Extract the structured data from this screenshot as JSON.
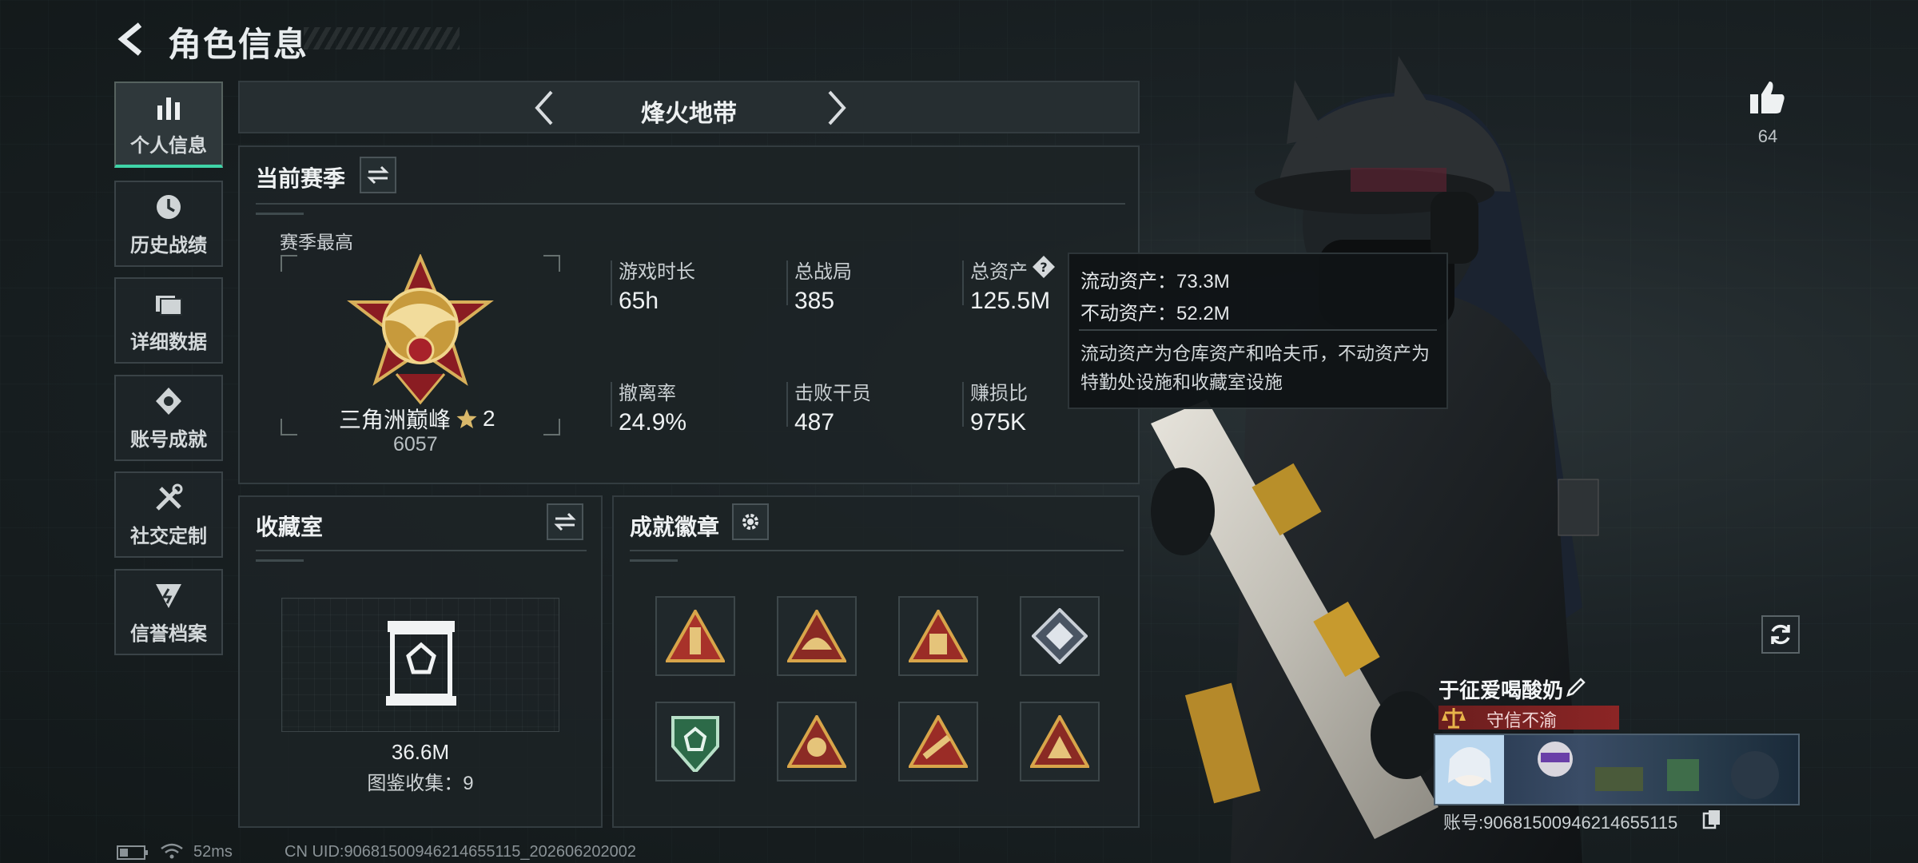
{
  "header": {
    "title": "角色信息"
  },
  "nav": {
    "items": [
      {
        "label": "个人信息",
        "icon": "bar-chart-icon",
        "active": true
      },
      {
        "label": "历史战绩",
        "icon": "history-icon",
        "active": false
      },
      {
        "label": "详细数据",
        "icon": "folder-icon",
        "active": false
      },
      {
        "label": "账号成就",
        "icon": "achievement-icon",
        "active": false
      },
      {
        "label": "社交定制",
        "icon": "tools-icon",
        "active": false
      },
      {
        "label": "信誉档案",
        "icon": "credit-icon",
        "active": false
      }
    ]
  },
  "mode": {
    "label": "烽火地带"
  },
  "season": {
    "title": "当前赛季",
    "best_label": "赛季最高",
    "rank_name": "三角洲巅峰",
    "rank_stars": "2",
    "rank_score": "6057",
    "stats": [
      {
        "label": "游戏时长",
        "value": "65h"
      },
      {
        "label": "总战局",
        "value": "385"
      },
      {
        "label": "总资产",
        "value": "125.5M"
      },
      {
        "label": "撤离率",
        "value": "24.9%"
      },
      {
        "label": "击败干员",
        "value": "487"
      },
      {
        "label": "赚损比",
        "value": "975K"
      }
    ]
  },
  "tooltip": {
    "liquid": "流动资产：73.3M",
    "fixed": "不动资产：52.2M",
    "desc": "流动资产为仓库资产和哈夫币，不动资产为特勤处设施和收藏室设施"
  },
  "collection": {
    "title": "收藏室",
    "value": "36.6M",
    "count": "图鉴收集：9"
  },
  "badges": {
    "title": "成就徽章"
  },
  "profile": {
    "likes": "64",
    "player_name": "于征爱喝酸奶",
    "reputation": "守信不渝",
    "account": "账号:9068150094621465511​5"
  },
  "status": {
    "ping": "52ms",
    "uid": "CN UID:9068150094621465511​5_202606202002"
  },
  "colors": {
    "accent": "#3fd4a8",
    "rep_red": "#8c2525"
  }
}
